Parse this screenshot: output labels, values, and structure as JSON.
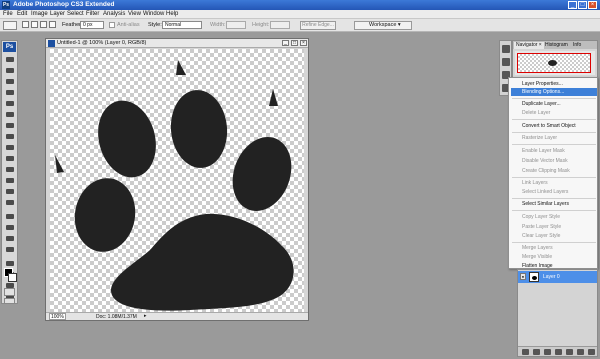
{
  "titlebar": {
    "title": "Adobe Photoshop CS3 Extended",
    "minimize": "_",
    "maximize": "□",
    "close": "×"
  },
  "menubar": {
    "items": [
      "File",
      "Edit",
      "Image",
      "Layer",
      "Select",
      "Filter",
      "Analysis",
      "View",
      "Window",
      "Help"
    ]
  },
  "options": {
    "feather_label": "Feather:",
    "feather_value": "0 px",
    "antialias_label": "Anti-alias",
    "style_label": "Style:",
    "style_value": "Normal",
    "width_label": "Width:",
    "height_label": "Height:",
    "refine_edge": "Refine Edge...",
    "workspace": "Workspace ▾"
  },
  "toolbox": {
    "logo": "Ps",
    "tool_icons": [
      "move-icon",
      "marquee-icon",
      "lasso-icon",
      "magic-wand-icon",
      "crop-icon",
      "slice-icon",
      "healing-icon",
      "brush-icon",
      "clone-stamp-icon",
      "history-brush-icon",
      "eraser-icon",
      "gradient-icon",
      "blur-icon",
      "dodge-icon",
      "pen-icon",
      "type-icon",
      "path-select-icon",
      "shape-icon",
      "notes-icon",
      "eyedropper-icon",
      "hand-icon",
      "zoom-icon"
    ],
    "foreground_color": "#000000"
  },
  "document": {
    "title": "Untitled-1 @ 100% (Layer 0, RGB/8)",
    "zoom": "100%",
    "doc_info": "Doc: 1.08M/1.37M",
    "paw_color": "#222222"
  },
  "navigator": {
    "tabs": [
      "Navigator ×",
      "Histogram",
      "Info"
    ]
  },
  "context_menu": {
    "items": [
      {
        "label": "Layer Properties...",
        "enabled": true
      },
      {
        "label": "Blending Options...",
        "enabled": true,
        "highlighted": true
      },
      {
        "label": "Duplicate Layer...",
        "enabled": true
      },
      {
        "label": "Delete Layer",
        "enabled": false
      },
      {
        "label": "Convert to Smart Object",
        "enabled": true
      },
      {
        "label": "Rasterize Layer",
        "enabled": false
      },
      {
        "label": "Enable Layer Mask",
        "enabled": false
      },
      {
        "label": "Disable Vector Mask",
        "enabled": false
      },
      {
        "label": "Create Clipping Mask",
        "enabled": false
      },
      {
        "label": "Link Layers",
        "enabled": false
      },
      {
        "label": "Select Linked Layers",
        "enabled": false
      },
      {
        "label": "Select Similar Layers",
        "enabled": true
      },
      {
        "label": "Copy Layer Style",
        "enabled": false
      },
      {
        "label": "Paste Layer Style",
        "enabled": false
      },
      {
        "label": "Clear Layer Style",
        "enabled": false
      },
      {
        "label": "Merge Layers",
        "enabled": false
      },
      {
        "label": "Merge Visible",
        "enabled": false
      },
      {
        "label": "Flatten Image",
        "enabled": true
      }
    ]
  },
  "layers": {
    "layer_name": "Layer 0",
    "selected_color": "#4d8fe8"
  },
  "colors": {
    "highlight": "#3d80d8",
    "titlebar": "#2d64c4"
  }
}
